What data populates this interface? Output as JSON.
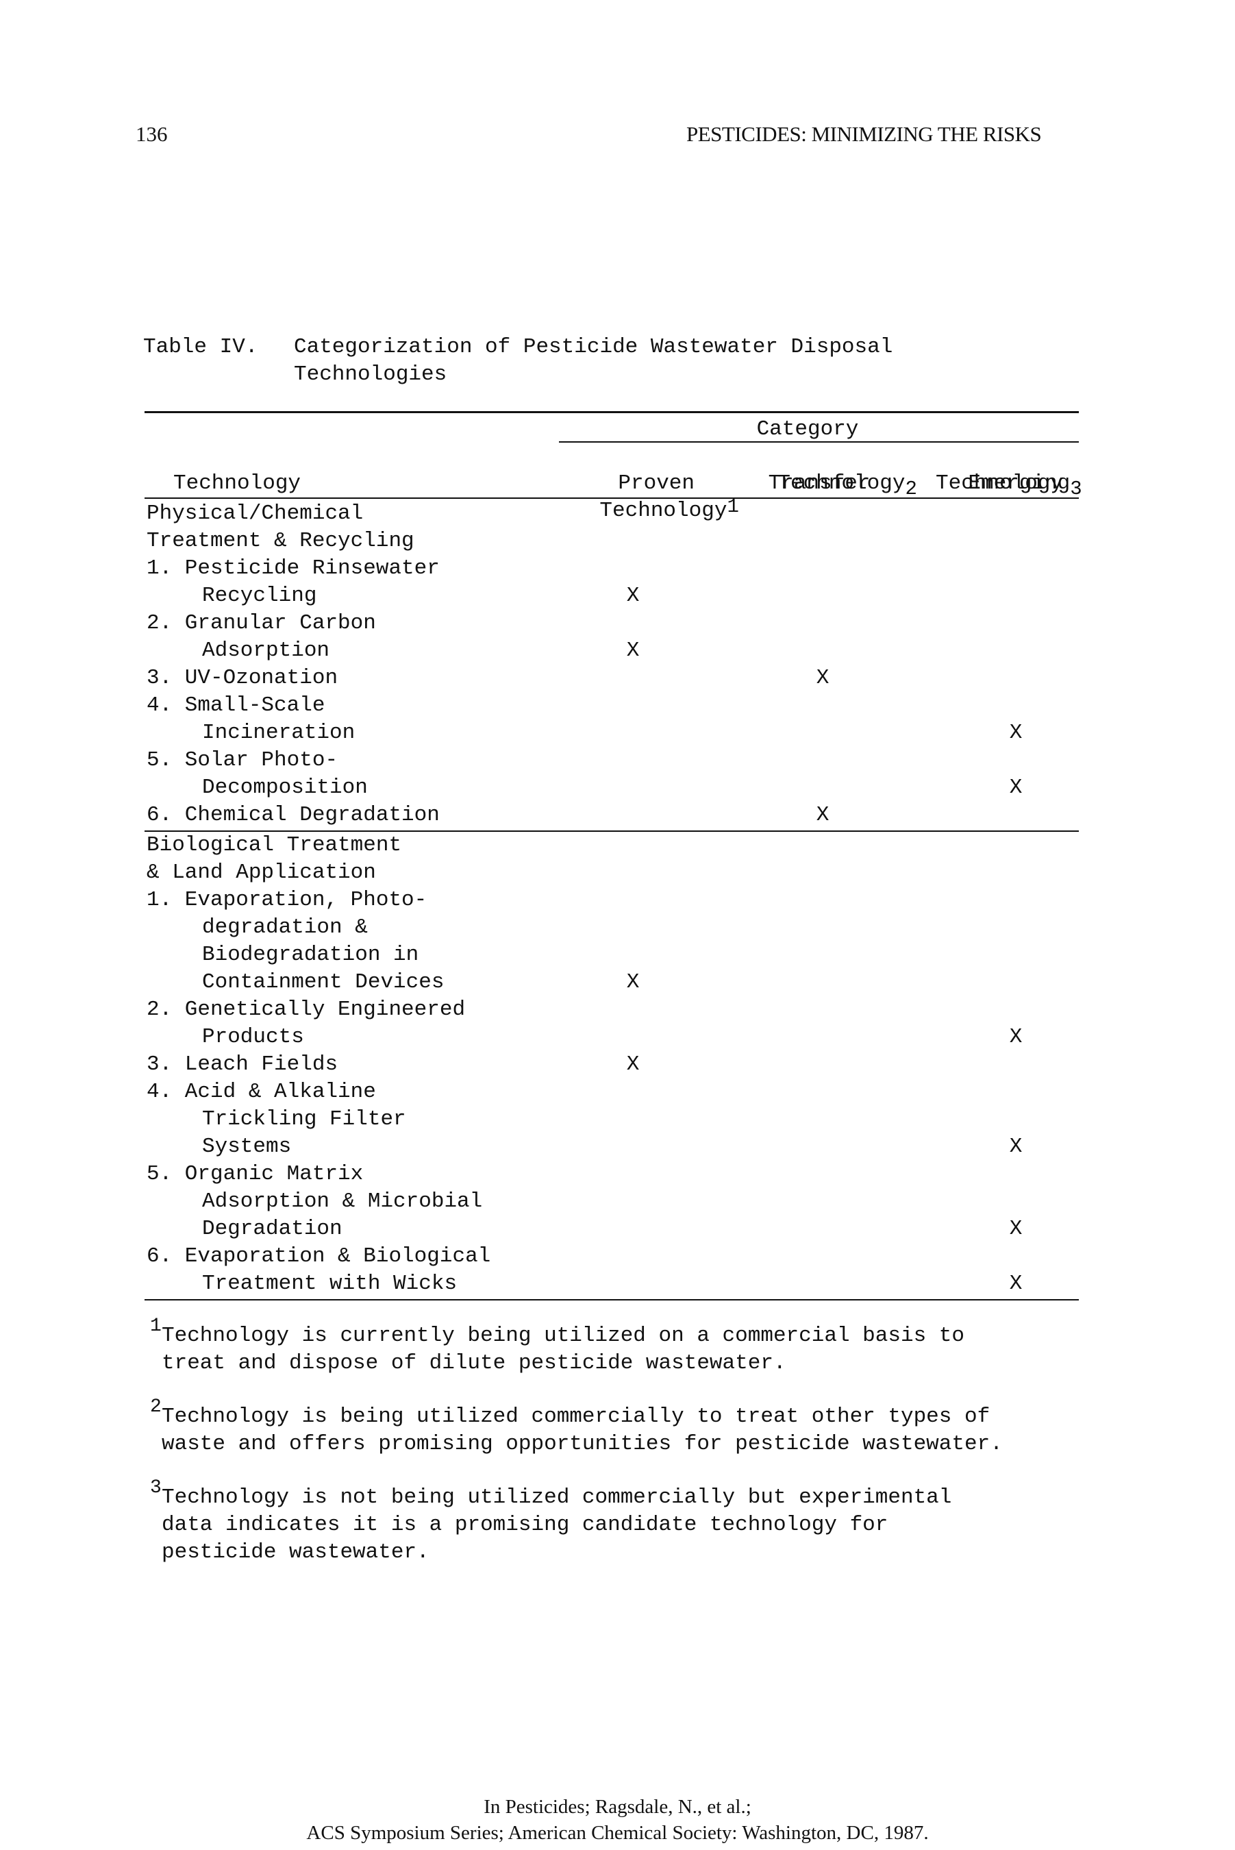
{
  "page": {
    "number": "136",
    "running_title": "PESTICIDES: MINIMIZING THE RISKS"
  },
  "table": {
    "label": "Table IV.",
    "title_line1": "Categorization of Pesticide Wastewater Disposal",
    "title_line2": "Technologies",
    "header": {
      "technology": "Technology",
      "category": "Category",
      "columns": [
        {
          "line1": "Proven",
          "line2": "Technology",
          "footnote": "1"
        },
        {
          "line1": "Technology",
          "line2": "Transfer",
          "footnote": "2"
        },
        {
          "line1": "Emerging",
          "line2": "Technology",
          "footnote": "3"
        }
      ]
    },
    "sections": [
      {
        "heading_lines": [
          "Physical/Chemical",
          "Treatment & Recycling"
        ],
        "rows": [
          {
            "lines": [
              "1. Pesticide Rinsewater",
              "Recycling"
            ],
            "category": "Proven Technology",
            "mark": "X"
          },
          {
            "lines": [
              "2. Granular Carbon",
              "Adsorption"
            ],
            "category": "Proven Technology",
            "mark": "X"
          },
          {
            "lines": [
              "3. UV-Ozonation"
            ],
            "category": "Technology Transfer",
            "mark": "X"
          },
          {
            "lines": [
              "4. Small-Scale",
              "Incineration"
            ],
            "category": "Emerging Technology",
            "mark": "X"
          },
          {
            "lines": [
              "5. Solar Photo-",
              "Decomposition"
            ],
            "category": "Emerging Technology",
            "mark": "X"
          },
          {
            "lines": [
              "6. Chemical Degradation"
            ],
            "category": "Technology Transfer",
            "mark": "X"
          }
        ]
      },
      {
        "heading_lines": [
          "Biological Treatment",
          "& Land Application"
        ],
        "rows": [
          {
            "lines": [
              "1. Evaporation, Photo-",
              "degradation &",
              "Biodegradation in",
              "Containment Devices"
            ],
            "category": "Proven Technology",
            "mark": "X"
          },
          {
            "lines": [
              "2. Genetically Engineered",
              "Products"
            ],
            "category": "Emerging Technology",
            "mark": "X"
          },
          {
            "lines": [
              "3. Leach Fields"
            ],
            "category": "Proven Technology",
            "mark": "X"
          },
          {
            "lines": [
              "4. Acid & Alkaline",
              "Trickling Filter",
              "Systems"
            ],
            "category": "Emerging Technology",
            "mark": "X"
          },
          {
            "lines": [
              "5. Organic Matrix",
              "Adsorption & Microbial",
              "Degradation"
            ],
            "category": "Emerging Technology",
            "mark": "X"
          },
          {
            "lines": [
              "6. Evaporation & Biological",
              "Treatment with Wicks"
            ],
            "category": "Emerging Technology",
            "mark": "X"
          }
        ]
      }
    ]
  },
  "footnotes": [
    {
      "num": "1",
      "lines": [
        "Technology is currently being utilized on a commercial basis to",
        "treat and dispose of dilute pesticide wastewater."
      ]
    },
    {
      "num": "2",
      "lines": [
        "Technology is being utilized commercially to treat other types of",
        "waste and offers promising opportunities for pesticide wastewater."
      ]
    },
    {
      "num": "3",
      "lines": [
        "Technology is not being utilized commercially but experimental",
        "data indicates it is a promising candidate technology for",
        "pesticide wastewater."
      ]
    }
  ],
  "citation": {
    "line1": "In Pesticides; Ragsdale, N., et al.;",
    "line2": "ACS Symposium Series; American Chemical Society: Washington, DC, 1987."
  }
}
